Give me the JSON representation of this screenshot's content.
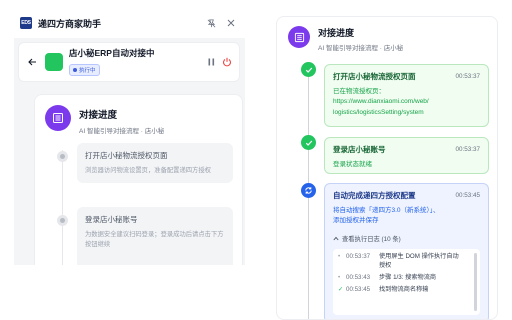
{
  "app": {
    "logo_text": "EDS",
    "title": "递四方商家助手"
  },
  "task": {
    "name": "店小秘ERP自动对接中",
    "status": "执行中"
  },
  "progress": {
    "title": "对接进度",
    "subtitle": "AI 智能引导对接流程 · 店小秘"
  },
  "left_steps": [
    {
      "title": "打开店小秘物流授权页面",
      "desc": "浏览器访问物流设置页，准备配置递四方授权"
    },
    {
      "title": "登录店小秘账号",
      "desc": "为数据安全建议扫码登录；登录成功后请点击下方按钮继续"
    }
  ],
  "right_steps": [
    {
      "title": "打开店小秘物流授权页面",
      "time": "00:53:37",
      "desc_lines": [
        "已在物流授权页：",
        "https://www.dianxiaomi.com/web/",
        "logistics/logisticsSetting/system"
      ]
    },
    {
      "title": "登录店小秘账号",
      "time": "00:53:37",
      "desc_lines": [
        "登录状态就绪"
      ]
    },
    {
      "title": "自动完成递四方授权配置",
      "time": "00:53:45",
      "desc_lines": [
        "将自动搜索「递四方3.0（新系统）」、",
        "添加授权并保存"
      ]
    }
  ],
  "log": {
    "toggle_label": "查看执行日志 (10 条)",
    "entries": [
      {
        "bullet": "•",
        "time": "00:53:37",
        "text": "使用屏生 DOM 操作执行自动授权"
      },
      {
        "bullet": "•",
        "time": "00:53:43",
        "text": "步骤 1/3: 搜索物流商"
      },
      {
        "bullet": "✓",
        "time": "00:53:45",
        "text": "找到物流商名称输"
      }
    ]
  },
  "colors": {
    "accent_purple": "#7c3aed",
    "success_green": "#22c55e",
    "active_blue": "#2563eb"
  }
}
